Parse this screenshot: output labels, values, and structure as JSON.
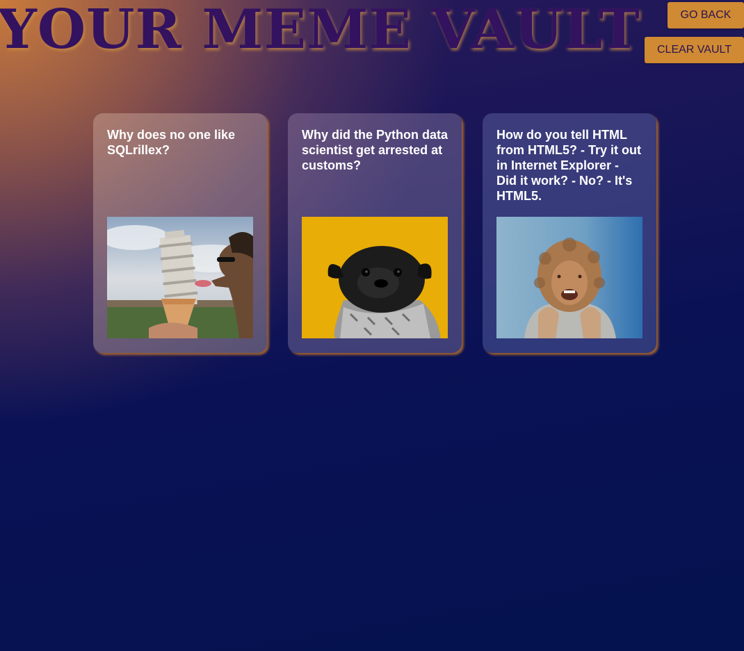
{
  "header": {
    "title": "YOUR MEME VAULT"
  },
  "buttons": {
    "go_back": "GO BACK",
    "clear_vault": "CLEAR VAULT"
  },
  "cards": [
    {
      "text": "Why does no one like SQLrillex?",
      "image": "photo-leaning-tower-ice-cream"
    },
    {
      "text": "Why did the Python data scientist get arrested at customs?",
      "image": "photo-pug-in-scarf"
    },
    {
      "text": "How do you tell HTML from HTML5? - Try it out in Internet Explorer - Did it work? - No? - It's HTML5.",
      "image": "photo-laughing-person-hoodie"
    }
  ],
  "colors": {
    "accent": "#d08a33",
    "title": "#33125f",
    "background": "#04124f"
  }
}
